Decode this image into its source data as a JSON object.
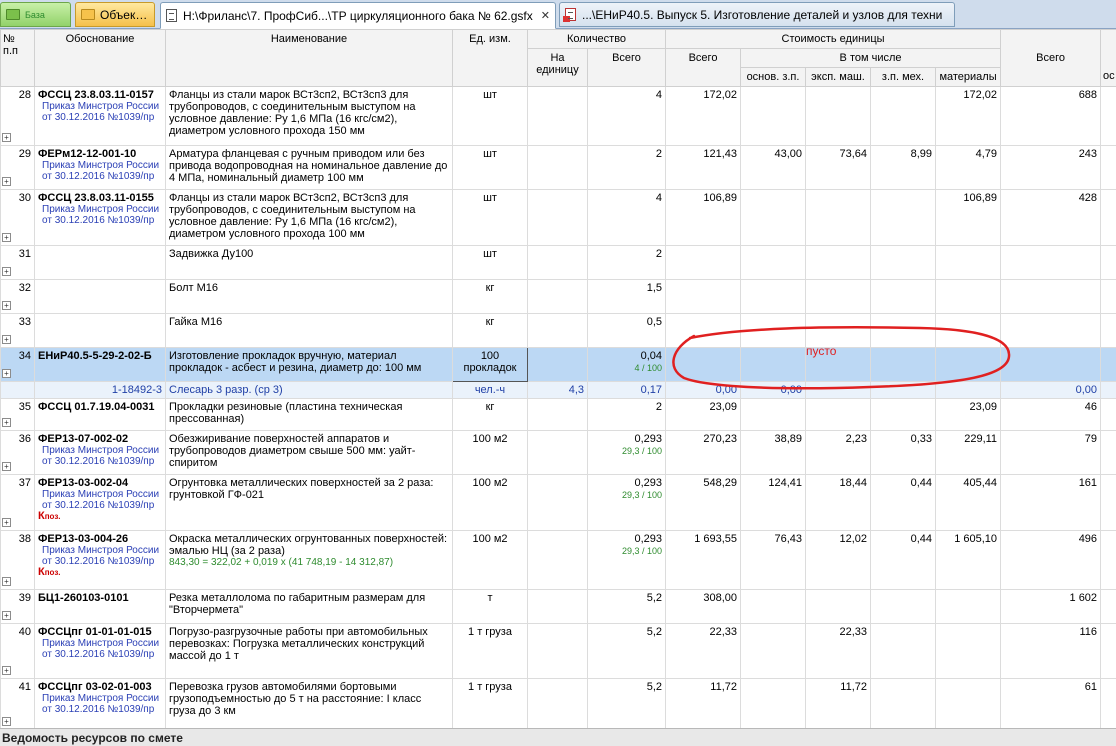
{
  "tabs": [
    {
      "label": "База",
      "icon": "database-icon",
      "style": "green"
    },
    {
      "label": "Объекты",
      "icon": "folder-icon",
      "style": "orange"
    },
    {
      "label": "Н:\\Фриланс\\7. ПрофСиб...\\ТР циркуляционного бака № 62.gsfx",
      "icon": "document-icon",
      "closable": true,
      "active": true
    },
    {
      "label": "...\\ЕНиР40.5. Выпуск 5. Изготовление деталей и узлов для техни",
      "icon": "document-icon"
    }
  ],
  "headers": {
    "num": "№ п.п",
    "basis": "Обоснование",
    "name": "Наименование",
    "unit": "Ед. изм.",
    "quantity": "Количество",
    "qty_per_unit": "На единицу",
    "qty_total": "Всего",
    "unit_cost": "Стоимость единицы",
    "uc_total": "Всего",
    "uc_incl": "В том числе",
    "uc_osn": "основ. з.п.",
    "uc_eksp": "эксп. маш.",
    "uc_mekh": "з.п. мех.",
    "uc_mat": "материалы",
    "total": "Всего",
    "last": "ос"
  },
  "rows": [
    {
      "n": "28",
      "code": "ФССЦ 23.8.03.11-0157",
      "sub": "Приказ Минстроя России от 30.12.2016 №1039/пр",
      "name": "Фланцы из стали марок ВСт3сп2, ВСт3сп3 для трубопроводов, с соединительным выступом на условное давление: Ру 1,6 МПа (16 кгс/см2), диаметром условного прохода 150 мм",
      "unit": "шт",
      "per_unit": "",
      "qty": "4",
      "qty_extra": "",
      "uc_total": "172,02",
      "osn": "",
      "eksp": "",
      "mekh": "",
      "mat": "172,02",
      "total": "688",
      "kpoz": false
    },
    {
      "n": "29",
      "code": "ФЕРм12-12-001-10",
      "sub": "Приказ Минстроя России от 30.12.2016 №1039/пр",
      "name": "Арматура фланцевая с ручным приводом или без привода водопроводная на номинальное давление до 4 МПа, номинальный диаметр 100 мм",
      "unit": "шт",
      "per_unit": "",
      "qty": "2",
      "qty_extra": "",
      "uc_total": "121,43",
      "osn": "43,00",
      "eksp": "73,64",
      "mekh": "8,99",
      "mat": "4,79",
      "total": "243",
      "kpoz": false
    },
    {
      "n": "30",
      "code": "ФССЦ 23.8.03.11-0155",
      "sub": "Приказ Минстроя России от 30.12.2016 №1039/пр",
      "name": "Фланцы из стали марок ВСт3сп2, ВСт3сп3 для трубопроводов, с соединительным выступом на условное давление: Ру 1,6 МПа (16 кгс/см2), диаметром условного прохода 100 мм",
      "unit": "шт",
      "per_unit": "",
      "qty": "4",
      "qty_extra": "",
      "uc_total": "106,89",
      "osn": "",
      "eksp": "",
      "mekh": "",
      "mat": "106,89",
      "total": "428",
      "kpoz": false
    },
    {
      "n": "31",
      "code": "",
      "sub": "",
      "name": "Задвижка Ду100",
      "unit": "шт",
      "per_unit": "",
      "qty": "2",
      "qty_extra": "",
      "uc_total": "",
      "osn": "",
      "eksp": "",
      "mekh": "",
      "mat": "",
      "total": "",
      "kpoz": false
    },
    {
      "n": "32",
      "code": "",
      "sub": "",
      "name": "Болт М16",
      "unit": "кг",
      "per_unit": "",
      "qty": "1,5",
      "qty_extra": "",
      "uc_total": "",
      "osn": "",
      "eksp": "",
      "mekh": "",
      "mat": "",
      "total": "",
      "kpoz": false
    },
    {
      "n": "33",
      "code": "",
      "sub": "",
      "name": "Гайка М16",
      "unit": "кг",
      "per_unit": "",
      "qty": "0,5",
      "qty_extra": "",
      "uc_total": "",
      "osn": "",
      "eksp": "",
      "mekh": "",
      "mat": "",
      "total": "",
      "kpoz": false
    },
    {
      "n": "34",
      "code": "ЕНиР40.5-5-29-2-02-Б",
      "sub": "",
      "name": "Изготовление прокладок вручную, материал прокладок - асбест и резина, диаметр до: 100 мм",
      "unit": "100 прокладок",
      "per_unit": "",
      "qty": "0,04",
      "qty_extra": "4 / 100",
      "uc_total": "",
      "osn": "",
      "eksp": "",
      "mekh": "",
      "mat": "",
      "total": "",
      "kpoz": false,
      "selected": true
    },
    {
      "n": "35",
      "code": "ФССЦ 01.7.19.04-0031",
      "sub": "",
      "name": "Прокладки резиновые (пластина техническая прессованная)",
      "unit": "кг",
      "per_unit": "",
      "qty": "2",
      "qty_extra": "",
      "uc_total": "23,09",
      "osn": "",
      "eksp": "",
      "mekh": "",
      "mat": "23,09",
      "total": "46",
      "kpoz": false
    },
    {
      "n": "36",
      "code": "ФЕР13-07-002-02",
      "sub": "Приказ Минстроя России от 30.12.2016 №1039/пр",
      "name": "Обезжиривание поверхностей аппаратов и трубопроводов диаметром свыше 500 мм: уайт-спиритом",
      "unit": "100 м2",
      "per_unit": "",
      "qty": "0,293",
      "qty_extra": "29,3 / 100",
      "uc_total": "270,23",
      "osn": "38,89",
      "eksp": "2,23",
      "mekh": "0,33",
      "mat": "229,11",
      "total": "79",
      "kpoz": false
    },
    {
      "n": "37",
      "code": "ФЕР13-03-002-04",
      "sub": "Приказ Минстроя России от 30.12.2016 №1039/пр",
      "name": "Огрунтовка металлических поверхностей за 2 раза: грунтовкой ГФ-021",
      "unit": "100 м2",
      "per_unit": "",
      "qty": "0,293",
      "qty_extra": "29,3 / 100",
      "uc_total": "548,29",
      "osn": "124,41",
      "eksp": "18,44",
      "mekh": "0,44",
      "mat": "405,44",
      "total": "161",
      "kpoz": true
    },
    {
      "n": "38",
      "code": "ФЕР13-03-004-26",
      "sub": "Приказ Минстроя России от 30.12.2016 №1039/пр",
      "name": "Окраска металлических огрунтованных поверхностей: эмалью НЦ (за 2 раза)",
      "formula": "843,30 = 322,02 + 0,019 x (41 748,19 - 14 312,87)",
      "unit": "100 м2",
      "per_unit": "",
      "qty": "0,293",
      "qty_extra": "29,3 / 100",
      "uc_total": "1 693,55",
      "osn": "76,43",
      "eksp": "12,02",
      "mekh": "0,44",
      "mat": "1 605,10",
      "total": "496",
      "kpoz": true
    },
    {
      "n": "39",
      "code": "БЦ1-260103-0101",
      "sub": "",
      "name": "Резка металлолома по габаритным размерам для \"Вторчермета\"",
      "unit": "т",
      "per_unit": "",
      "qty": "5,2",
      "qty_extra": "",
      "uc_total": "308,00",
      "osn": "",
      "eksp": "",
      "mekh": "",
      "mat": "",
      "total": "1 602",
      "kpoz": false
    },
    {
      "n": "40",
      "code": "ФССЦпг 01-01-01-015",
      "sub": "Приказ Минстроя России от 30.12.2016 №1039/пр",
      "name": "Погрузо-разгрузочные работы при автомобильных перевозках: Погрузка металлических конструкций массой до 1 т",
      "unit": "1 т груза",
      "per_unit": "",
      "qty": "5,2",
      "qty_extra": "",
      "uc_total": "22,33",
      "osn": "",
      "eksp": "22,33",
      "mekh": "",
      "mat": "",
      "total": "116",
      "kpoz": false
    },
    {
      "n": "41",
      "code": "ФССЦпг 03-02-01-003",
      "sub": "Приказ Минстроя России от 30.12.2016 №1039/пр",
      "name": "Перевозка грузов автомобилями бортовыми грузоподъемностью до 5 т на расстояние: I класс груза до 3 км",
      "unit": "1 т груза",
      "per_unit": "",
      "qty": "5,2",
      "qty_extra": "",
      "uc_total": "11,72",
      "osn": "",
      "eksp": "11,72",
      "mekh": "",
      "mat": "",
      "total": "61",
      "kpoz": false
    }
  ],
  "resource_row": {
    "code": "1-18492-3",
    "name": "Слесарь 3 разр. (ср 3)",
    "unit": "чел.-ч",
    "per_unit": "4,3",
    "qty": "0,17",
    "uc_total": "0,00",
    "osn": "0,00",
    "total": "0,00"
  },
  "kpoz_label": "К",
  "kpoz_sub": "поз.",
  "annotation_text": "пусто",
  "annotation_color": "#e02020",
  "statusbar": "Ведомость ресурсов по смете"
}
